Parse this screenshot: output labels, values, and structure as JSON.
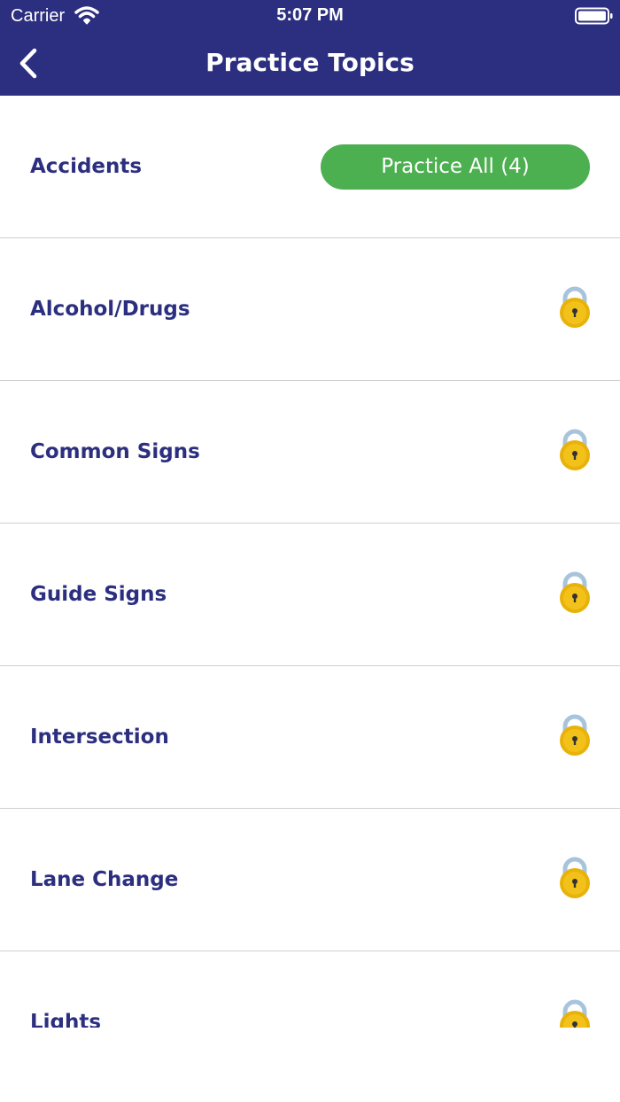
{
  "status_bar": {
    "carrier": "Carrier",
    "time": "5:07 PM"
  },
  "nav": {
    "title": "Practice Topics",
    "back_icon": "chevron-left-icon"
  },
  "topics": [
    {
      "label": "Accidents",
      "action": {
        "type": "button",
        "label": "Practice All (4)"
      }
    },
    {
      "label": "Alcohol/Drugs",
      "action": {
        "type": "lock-icon"
      }
    },
    {
      "label": "Common Signs",
      "action": {
        "type": "lock-icon"
      }
    },
    {
      "label": "Guide Signs",
      "action": {
        "type": "lock-icon"
      }
    },
    {
      "label": "Intersection",
      "action": {
        "type": "lock-icon"
      }
    },
    {
      "label": "Lane Change",
      "action": {
        "type": "lock-icon"
      }
    },
    {
      "label": "Lights",
      "action": {
        "type": "lock-icon"
      }
    }
  ],
  "colors": {
    "header_bg": "#2c2f7f",
    "topic_text": "#2c2f7f",
    "practice_button": "#4caf50",
    "lock_body": "#e8b20a",
    "lock_shackle": "#a8c4dc",
    "divider": "#cfcfd4"
  }
}
